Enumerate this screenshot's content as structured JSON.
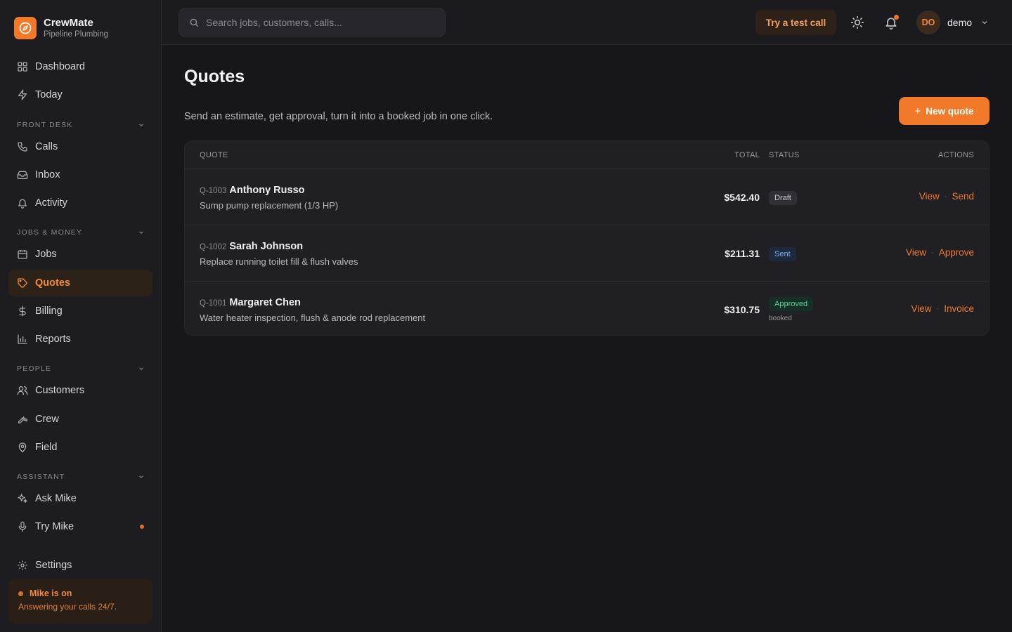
{
  "brand": {
    "name": "CrewMate",
    "subtitle": "Pipeline Plumbing"
  },
  "sidebar": {
    "top_items": [
      {
        "label": "Dashboard",
        "icon": "grid-icon"
      },
      {
        "label": "Today",
        "icon": "bolt-icon"
      }
    ],
    "sections": [
      {
        "label": "FRONT DESK",
        "items": [
          {
            "label": "Calls",
            "icon": "phone-icon"
          },
          {
            "label": "Inbox",
            "icon": "inbox-icon"
          },
          {
            "label": "Activity",
            "icon": "bell-icon"
          }
        ]
      },
      {
        "label": "JOBS & MONEY",
        "items": [
          {
            "label": "Jobs",
            "icon": "calendar-icon"
          },
          {
            "label": "Quotes",
            "icon": "tag-icon",
            "active": true
          },
          {
            "label": "Billing",
            "icon": "dollar-icon"
          },
          {
            "label": "Reports",
            "icon": "bar-chart-icon"
          }
        ]
      },
      {
        "label": "PEOPLE",
        "items": [
          {
            "label": "Customers",
            "icon": "users-icon"
          },
          {
            "label": "Crew",
            "icon": "wrench-icon"
          },
          {
            "label": "Field",
            "icon": "map-pin-icon"
          }
        ]
      },
      {
        "label": "ASSISTANT",
        "items": [
          {
            "label": "Ask Mike",
            "icon": "sparkles-icon"
          },
          {
            "label": "Try Mike",
            "icon": "mic-icon"
          }
        ]
      }
    ],
    "settings_label": "Settings",
    "status_card": {
      "title": "Mike is on",
      "subtitle": "Answering your calls 24/7."
    }
  },
  "topbar": {
    "search_placeholder": "Search jobs, customers, calls...",
    "test_call_label": "Try a test call",
    "user": {
      "initials": "DO",
      "name": "demo"
    }
  },
  "page": {
    "title": "Quotes",
    "description": "Send an estimate, get approval, turn it into a booked job in one click.",
    "new_quote_label": "New quote"
  },
  "table": {
    "columns": {
      "quote": "QUOTE",
      "total": "TOTAL",
      "status": "STATUS",
      "actions": "ACTIONS"
    },
    "rows": [
      {
        "id": "Q-1003",
        "customer": "Anthony Russo",
        "description": "Sump pump replacement (1/3 HP)",
        "total": "$542.40",
        "status": "Draft",
        "note": "",
        "actions": [
          "View",
          "Send"
        ]
      },
      {
        "id": "Q-1002",
        "customer": "Sarah Johnson",
        "description": "Replace running toilet fill & flush valves",
        "total": "$211.31",
        "status": "Sent",
        "note": "",
        "actions": [
          "View",
          "Approve"
        ]
      },
      {
        "id": "Q-1001",
        "customer": "Margaret Chen",
        "description": "Water heater inspection, flush & anode rod replacement",
        "total": "$310.75",
        "status": "Approved",
        "note": "booked",
        "actions": [
          "View",
          "Invoice"
        ]
      }
    ]
  },
  "colors": {
    "accent": "#f07a2a",
    "background": "#17171b",
    "sidebar": "#1c1c21",
    "draft": "#c8c8ce",
    "sent": "#7fb0f0",
    "approved": "#5fd09a"
  }
}
